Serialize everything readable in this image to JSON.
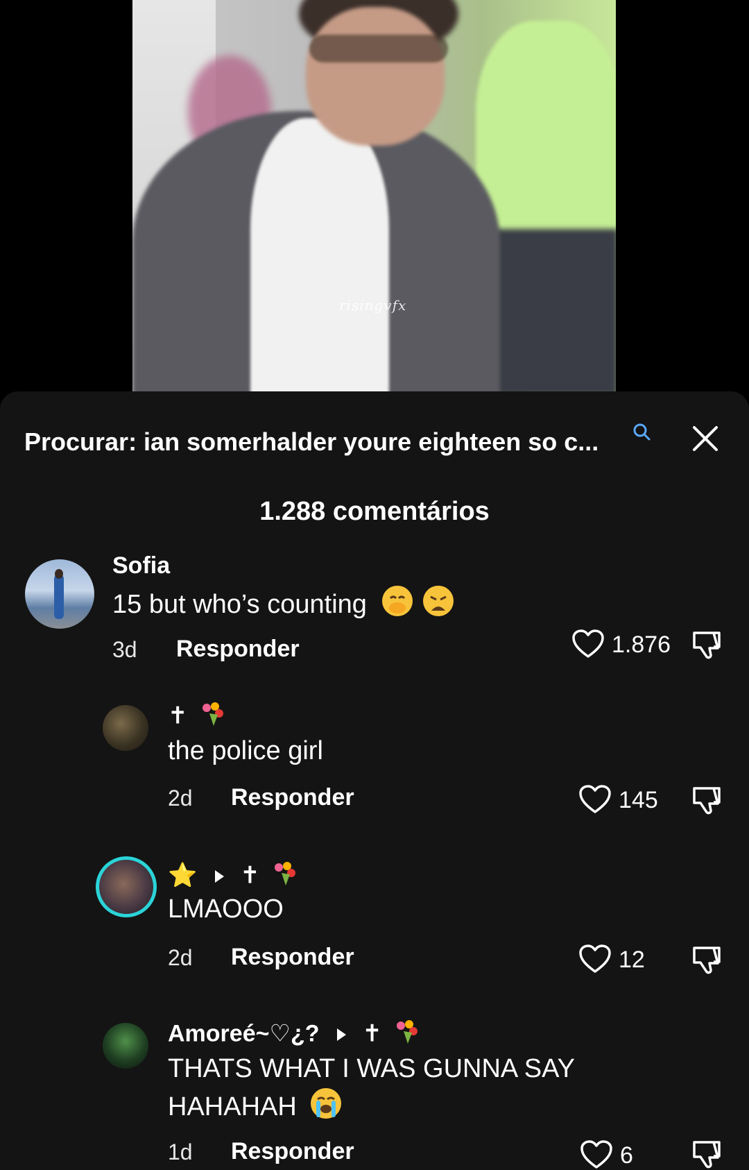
{
  "video": {
    "watermark": "risingvfx"
  },
  "header": {
    "search_label": "Procurar: ian somerhalder youre eighteen so c...",
    "search_icon": "search-icon",
    "close_icon": "close-icon"
  },
  "comments_count": "1.288 comentários",
  "comments": [
    {
      "username": "Sofia",
      "text": "15 but who’s counting",
      "time": "3d",
      "reply": "Responder",
      "likes": "1.876"
    },
    {
      "username_prefix": "✝",
      "text": "the police girl",
      "time": "2d",
      "reply": "Responder",
      "likes": "145"
    },
    {
      "username_prefix": "⭐",
      "username_target": "✝",
      "text": "LMAOOO",
      "time": "2d",
      "reply": "Responder",
      "likes": "12"
    },
    {
      "username": "Amoreé~♡¿?",
      "username_target": "✝",
      "text_line1": "THATS WHAT I WAS GUNNA SAY",
      "text_line2": "HAHAHAH",
      "time": "1d",
      "reply": "Responder",
      "likes": "6"
    }
  ]
}
